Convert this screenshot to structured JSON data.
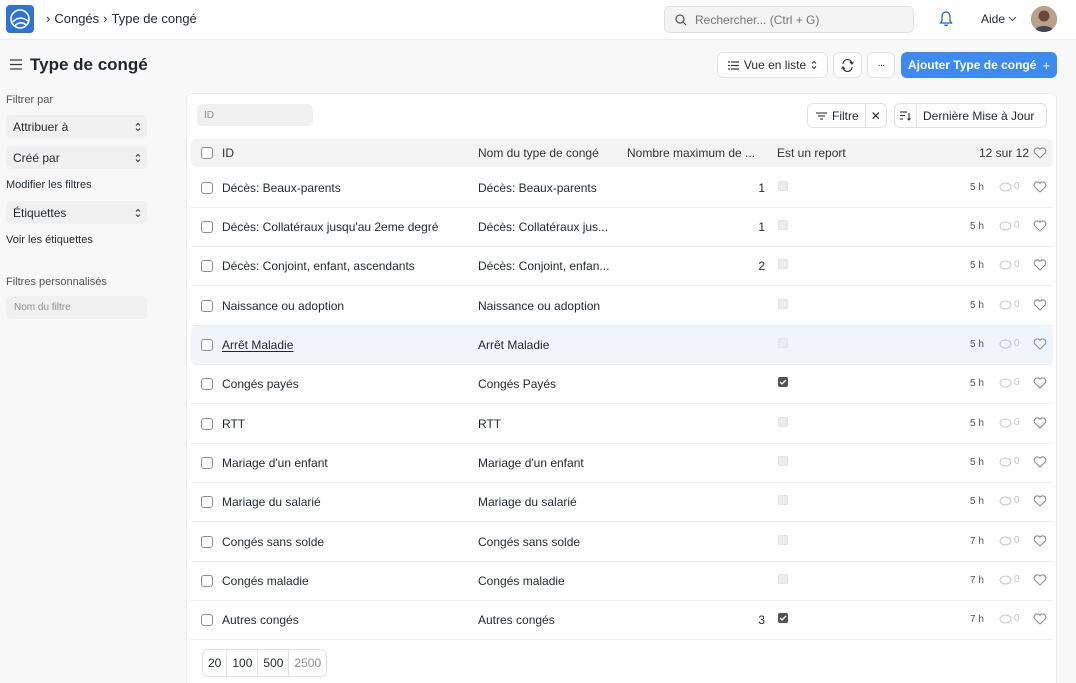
{
  "breadcrumb": [
    "Congés",
    "Type de congé"
  ],
  "search": {
    "placeholder": "Rechercher... (Ctrl + G)"
  },
  "help_label": "Aide",
  "page_title": "Type de congé",
  "toolbar": {
    "view_label": "Vue en liste",
    "more_label": "···",
    "add_label": "Ajouter Type de congé"
  },
  "sidebar": {
    "filter_by": "Filtrer par",
    "assigned_to": "Attribuer à",
    "created_by": "Créé par",
    "edit_filters": "Modifier les filtres",
    "tags": "Étiquettes",
    "show_tags": "Voir les étiquettes",
    "custom_filters": "Filtres personnalisés",
    "filter_name_placeholder": "Nom du filtre"
  },
  "list": {
    "id_placeholder": "ID",
    "filter_label": "Filtre",
    "sort_label": "Dernière Mise à Jour",
    "columns": {
      "id": "ID",
      "name": "Nom du type de congé",
      "max": "Nombre maximum de ...",
      "report": "Est un report"
    },
    "count": "12 sur 12",
    "rows": [
      {
        "id": "Décès: Beaux-parents",
        "name": "Décès: Beaux-parents",
        "max": "1",
        "report": false,
        "time": "5 h",
        "comments": "0"
      },
      {
        "id": "Décès: Collatéraux jusqu'au 2eme degré",
        "name": "Décès: Collatéraux jus...",
        "max": "1",
        "report": false,
        "time": "5 h",
        "comments": "0"
      },
      {
        "id": "Décès: Conjoint, enfant, ascendants",
        "name": "Décès: Conjoint, enfan...",
        "max": "2",
        "report": false,
        "time": "5 h",
        "comments": "0"
      },
      {
        "id": "Naissance ou adoption",
        "name": "Naissance ou adoption",
        "max": "",
        "report": false,
        "time": "5 h",
        "comments": "0"
      },
      {
        "id": "Arrêt Maladie",
        "name": "Arrêt Maladie",
        "max": "",
        "report": false,
        "time": "5 h",
        "comments": "0"
      },
      {
        "id": "Congés payés",
        "name": "Congés Payés",
        "max": "",
        "report": true,
        "time": "5 h",
        "comments": "0"
      },
      {
        "id": "RTT",
        "name": "RTT",
        "max": "",
        "report": false,
        "time": "5 h",
        "comments": "0"
      },
      {
        "id": "Mariage d'un enfant",
        "name": "Mariage d'un enfant",
        "max": "",
        "report": false,
        "time": "5 h",
        "comments": "0"
      },
      {
        "id": "Mariage du salarié",
        "name": "Mariage du salarié",
        "max": "",
        "report": false,
        "time": "5 h",
        "comments": "0"
      },
      {
        "id": "Congés sans solde",
        "name": "Congés sans solde",
        "max": "",
        "report": false,
        "time": "7 h",
        "comments": "0"
      },
      {
        "id": "Congés maladie",
        "name": "Congés maladie",
        "max": "",
        "report": false,
        "time": "7 h",
        "comments": "0"
      },
      {
        "id": "Autres congés",
        "name": "Autres congés",
        "max": "3",
        "report": true,
        "time": "7 h",
        "comments": "0"
      }
    ],
    "page_sizes": [
      "20",
      "100",
      "500",
      "2500"
    ]
  },
  "colors": {
    "primary": "#3d8bf2",
    "logo": "#2f73d6",
    "highlight": "#eef5fb"
  }
}
